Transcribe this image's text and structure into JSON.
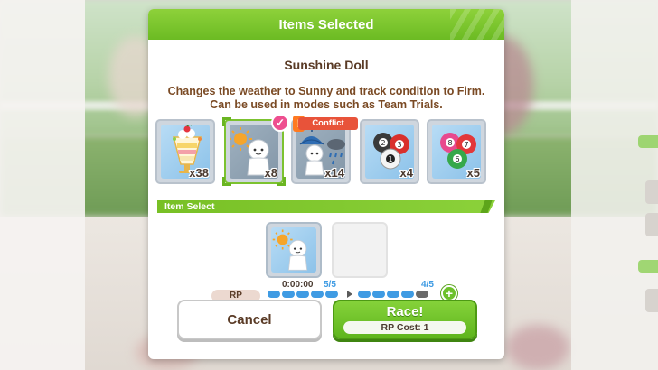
{
  "dialog": {
    "title": "Items Selected",
    "item_name": "Sunshine Doll",
    "item_description": "Changes the weather to Sunny and track condition to Firm. Can be used in modes such as Team Trials."
  },
  "items": [
    {
      "name": "parfait",
      "icon": "parfait-icon",
      "count": "x38",
      "selected": false
    },
    {
      "name": "sunshine-doll",
      "icon": "sunshine-doll-icon",
      "count": "x8",
      "selected": true
    },
    {
      "name": "rain-doll",
      "icon": "rain-doll-icon",
      "count": "x14",
      "selected": false,
      "tag": "Conflict"
    },
    {
      "name": "lottery-balls-123",
      "icon": "lottery-balls-icon",
      "count": "x4",
      "selected": false
    },
    {
      "name": "lottery-balls-867",
      "icon": "colored-balls-icon",
      "count": "x5",
      "selected": false
    }
  ],
  "item_select": {
    "label": "Item Select",
    "slots": [
      {
        "filled": true,
        "icon": "sunshine-doll-icon"
      },
      {
        "filled": false
      }
    ]
  },
  "rp": {
    "label": "RP",
    "timer": "0:00:00",
    "current": "5/5",
    "after": "4/5",
    "current_value": 5,
    "after_value": 4,
    "max": 5
  },
  "buttons": {
    "cancel": "Cancel",
    "race": "Race!",
    "rp_cost": "RP Cost: 1"
  },
  "colors": {
    "header_green": "#7cc52c",
    "rp_blue": "#3f9be3",
    "conflict_red": "#e8533a",
    "text_brown": "#5a3b26"
  }
}
